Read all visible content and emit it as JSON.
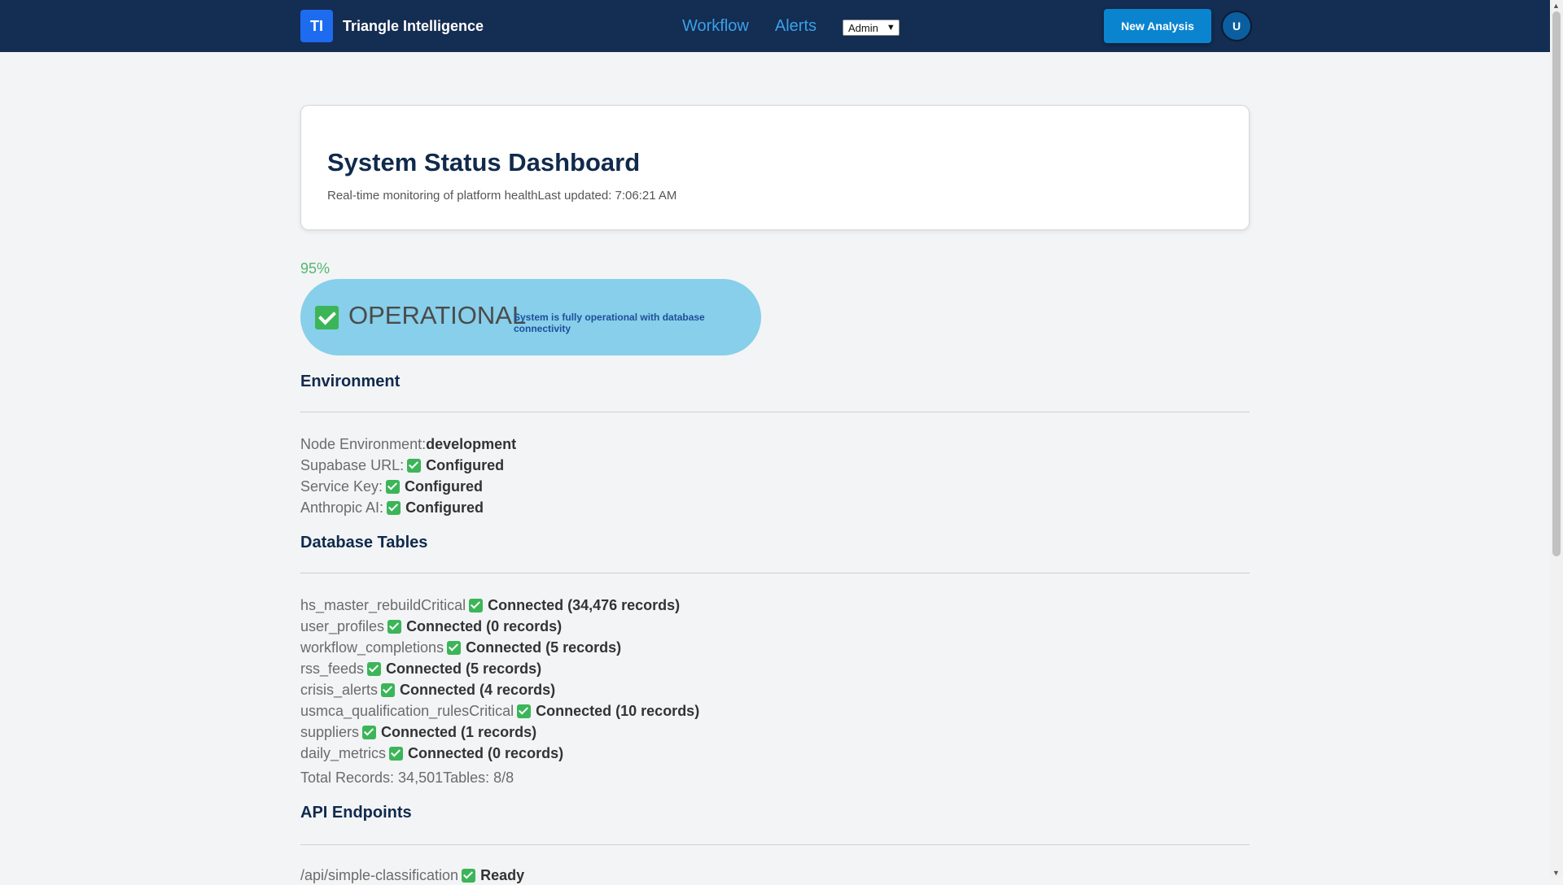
{
  "nav": {
    "logo_text": "TI",
    "brand": "Triangle Intelligence",
    "links": [
      "Workflow",
      "Alerts"
    ],
    "role_select": "Admin",
    "new_analysis": "New Analysis",
    "avatar": "U",
    "colors": {
      "bar": "#142d52",
      "accent": "#1d6cf0",
      "link": "#3aa0ea",
      "button": "#0b84d0"
    }
  },
  "header": {
    "title": "System Status Dashboard",
    "subtitle": "Real-time monitoring of platform health",
    "updated": "Last updated: 7:06:21 AM"
  },
  "status": {
    "percent": "95%",
    "label": "OPERATIONAL",
    "message": "System is fully operational with database connectivity",
    "colors": {
      "pill": "#87cfea",
      "ok": "#3cb558"
    }
  },
  "environment": {
    "title": "Environment",
    "rows": [
      {
        "key": "Node Environment:",
        "value": "development"
      },
      {
        "key": "Supabase URL:",
        "value": "Configured"
      },
      {
        "key": "Service Key:",
        "value": "Configured"
      },
      {
        "key": "Anthropic AI:",
        "value": "Configured"
      }
    ]
  },
  "database": {
    "title": "Database Tables",
    "rows": [
      {
        "name": "hs_master_rebuild",
        "tag": "Critical",
        "status": "Connected (34,476 records)"
      },
      {
        "name": "user_profiles",
        "tag": "",
        "status": "Connected (0 records)"
      },
      {
        "name": "workflow_completions",
        "tag": "",
        "status": "Connected (5 records)"
      },
      {
        "name": "rss_feeds",
        "tag": "",
        "status": "Connected (5 records)"
      },
      {
        "name": "crisis_alerts",
        "tag": "",
        "status": "Connected (4 records)"
      },
      {
        "name": "usmca_qualification_rules",
        "tag": "Critical",
        "status": "Connected (10 records)"
      },
      {
        "name": "suppliers",
        "tag": "",
        "status": "Connected (1 records)"
      },
      {
        "name": "daily_metrics",
        "tag": "",
        "status": "Connected (0 records)"
      }
    ],
    "total_records": "Total Records: 34,501",
    "tables": "Tables: 8/8"
  },
  "api": {
    "title": "API Endpoints",
    "rows": [
      {
        "path": "/api/simple-classification",
        "status": "Ready"
      }
    ]
  }
}
